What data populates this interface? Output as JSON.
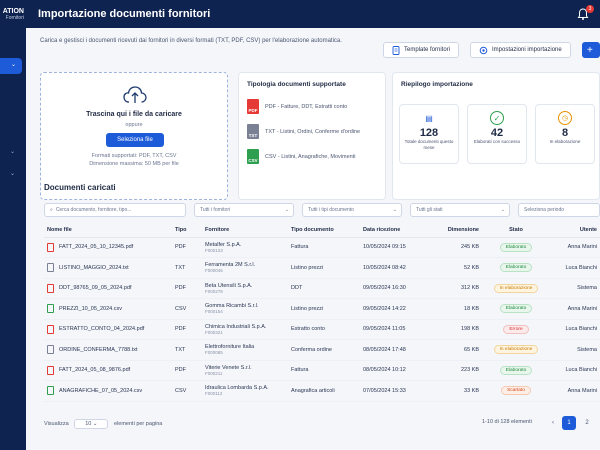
{
  "sidebar": {
    "brand": "ATION",
    "brand_sub": "Fornitori"
  },
  "header": {
    "title": "Importazione documenti fornitori",
    "notif_count": "3"
  },
  "page": {
    "description": "Carica e gestisci i documenti ricevuti dai fornitori in diversi formati (TXT, PDF, CSV) per l'elaborazione automatica."
  },
  "toolbar": {
    "templates_label": "Template fornitori",
    "settings_label": "Impostazioni importazione"
  },
  "upload": {
    "title": "Trascina qui i file da caricare",
    "or": "oppure",
    "select_label": "Seleziona file",
    "formats": "Formati supportati: PDF, TXT, CSV",
    "max_size": "Dimensione massima: 50 MB per file"
  },
  "types": {
    "title": "Tipologia documenti supportate",
    "items": [
      {
        "ext": "PDF",
        "desc": "PDF - Fatture, DDT, Estratti conto",
        "color": "#e53935"
      },
      {
        "ext": "TXT",
        "desc": "TXT - Listini, Ordini, Conferme d'ordine",
        "color": "#7b8194"
      },
      {
        "ext": "CSV",
        "desc": "CSV - Listini, Anagrafiche, Movimenti",
        "color": "#2e9e4f"
      }
    ]
  },
  "summary": {
    "title": "Riepilogo importazione",
    "stats": [
      {
        "value": "128",
        "label": "Totale documenti questo mese",
        "color": "#1e5bd8"
      },
      {
        "value": "42",
        "label": "Elaborati con successo",
        "color": "#2e9e4f"
      },
      {
        "value": "8",
        "label": "In elaborazione",
        "color": "#e69500"
      }
    ]
  },
  "table": {
    "title": "Documenti caricati",
    "search_placeholder": "Cerca documento, fornitore, tipo...",
    "filter_suppliers": "Tutti i fornitori",
    "filter_types": "Tutti i tipi documento",
    "filter_states": "Tutti gli stati",
    "filter_period": "Seleziona periodo",
    "columns": [
      "Nome file",
      "Tipo",
      "Fornitore",
      "Tipo documento",
      "Data ricezione",
      "Dimensione",
      "Stato",
      "Utente"
    ],
    "rows": [
      {
        "file": "FATT_2024_05_10_12345.pdf",
        "type": "PDF",
        "supplier": "Metalfer S.p.A.",
        "code": "F000123",
        "doctype": "Fattura",
        "date": "10/05/2024 09:15",
        "size": "245 KB",
        "status": "Elaborato",
        "status_class": "b-ok",
        "user": "Anna Marini"
      },
      {
        "file": "LISTINO_MAGGIO_2024.txt",
        "type": "TXT",
        "supplier": "Ferramenta 2M S.r.l.",
        "code": "F000045",
        "doctype": "Listino prezzi",
        "date": "10/05/2024 08:42",
        "size": "52 KB",
        "status": "Elaborato",
        "status_class": "b-ok",
        "user": "Luca Bianchi"
      },
      {
        "file": "DDT_98765_09_05_2024.pdf",
        "type": "PDF",
        "supplier": "Beta Utensili S.p.A.",
        "code": "F000278",
        "doctype": "DDT",
        "date": "09/05/2024 16:30",
        "size": "312 KB",
        "status": "In elaborazione",
        "status_class": "b-wait",
        "user": "Sistema"
      },
      {
        "file": "PREZZI_10_05_2024.csv",
        "type": "CSV",
        "supplier": "Gomma Ricambi S.r.l.",
        "code": "F000154",
        "doctype": "Listino prezzi",
        "date": "09/05/2024 14:22",
        "size": "18 KB",
        "status": "Elaborato",
        "status_class": "b-ok",
        "user": "Anna Marini"
      },
      {
        "file": "ESTRATTO_CONTO_04_2024.pdf",
        "type": "PDF",
        "supplier": "Chimica Industriali S.p.A.",
        "code": "F000321",
        "doctype": "Estratto conto",
        "date": "09/05/2024 11:05",
        "size": "198 KB",
        "status": "Errore",
        "status_class": "b-err",
        "user": "Luca Bianchi"
      },
      {
        "file": "ORDINE_CONFERMA_7788.txt",
        "type": "TXT",
        "supplier": "Elettroforniture Italia",
        "code": "F000085",
        "doctype": "Conferma ordine",
        "date": "08/05/2024 17:48",
        "size": "65 KB",
        "status": "In elaborazione",
        "status_class": "b-wait",
        "user": "Sistema"
      },
      {
        "file": "FATT_2024_05_08_9876.pdf",
        "type": "PDF",
        "supplier": "Viterie Venete S.r.l.",
        "code": "F000211",
        "doctype": "Fattura",
        "date": "08/05/2024 10:12",
        "size": "223 KB",
        "status": "Elaborato",
        "status_class": "b-ok",
        "user": "Luca Bianchi"
      },
      {
        "file": "ANAGRAFICHE_07_05_2024.csv",
        "type": "CSV",
        "supplier": "Idraulica Lombarda S.p.A.",
        "code": "F000112",
        "doctype": "Anagrafica articoli",
        "date": "07/05/2024 15:33",
        "size": "33 KB",
        "status": "Scartato",
        "status_class": "b-skip",
        "user": "Anna Marini"
      }
    ],
    "show_label": "Visualizza",
    "page_size": "10",
    "per_page": "elementi per pagina",
    "range": "1-10 di 128 elementi",
    "page1": "1",
    "page2": "2"
  }
}
